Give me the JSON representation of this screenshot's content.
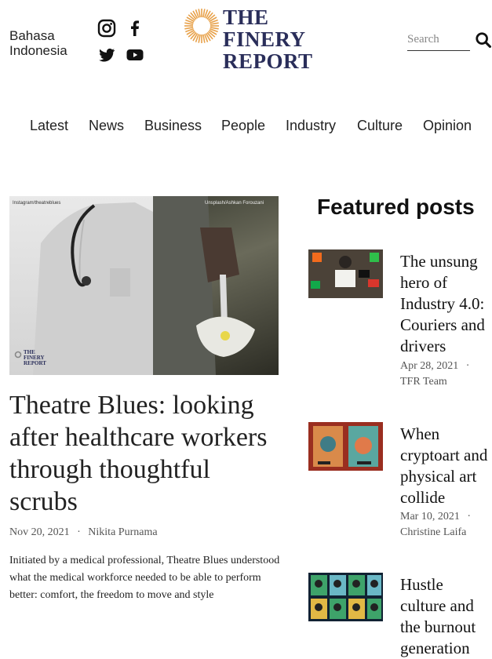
{
  "header": {
    "language_line1": "Bahasa",
    "language_line2": "Indonesia",
    "logo_lines": [
      "THE",
      "FINERY",
      "REPORT"
    ],
    "search_placeholder": "Search",
    "logo_color": "#2a2e5a",
    "sunburst_color": "#e8a24b"
  },
  "social": [
    "instagram-icon",
    "facebook-icon",
    "twitter-icon",
    "youtube-icon"
  ],
  "nav": [
    "Latest",
    "News",
    "Business",
    "People",
    "Industry",
    "Culture",
    "Opinion"
  ],
  "main": {
    "image_caption_left": "Instagram/theatreblues",
    "image_caption_right": "Unsplash/Ashkan Forouzani",
    "image_logo_lines": [
      "THE",
      "FINERY",
      "REPORT"
    ],
    "headline": "Theatre Blues: looking after healthcare workers through thoughtful scrubs",
    "date": "Nov 20, 2021",
    "separator": "·",
    "author": "Nikita Purnama",
    "excerpt": "Initiated by a medical professional, Theatre Blues understood what the medical workforce needed to be able to perform better: comfort, the freedom to move and style"
  },
  "featured": {
    "title": "Featured posts",
    "separator": "·",
    "posts": [
      {
        "title": "The unsung hero of Industry 4.0: Couriers and drivers",
        "date": "Apr 28, 2021",
        "author": "TFR Team"
      },
      {
        "title": "When cryptoart and physical art collide",
        "date": "Mar 10, 2021",
        "author": "Christine Laifa"
      },
      {
        "title": "Hustle culture and the burnout generation",
        "date": "",
        "author": ""
      }
    ]
  }
}
